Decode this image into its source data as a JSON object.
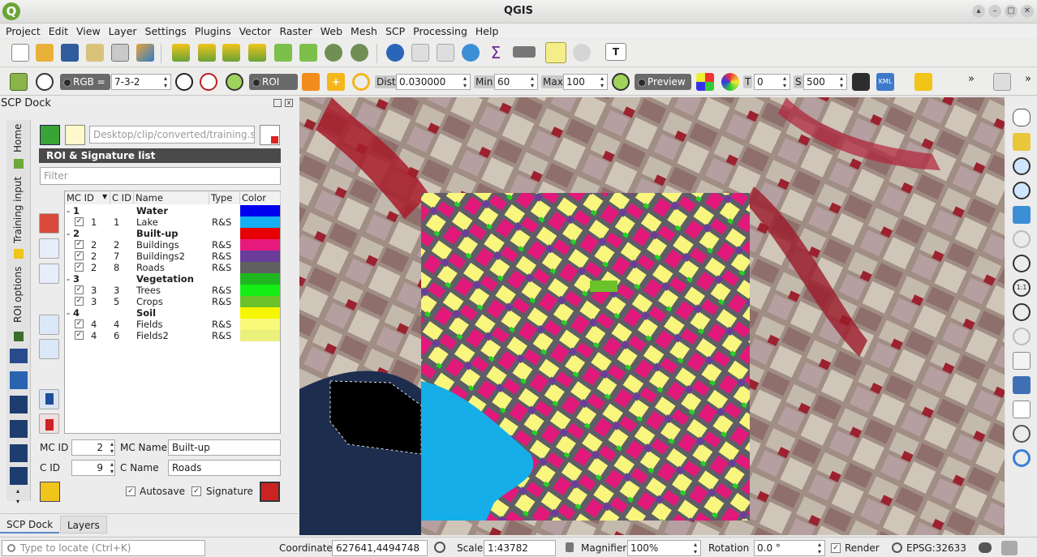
{
  "window": {
    "title": "QGIS"
  },
  "menu": [
    "Project",
    "Edit",
    "View",
    "Layer",
    "Settings",
    "Plugins",
    "Vector",
    "Raster",
    "Web",
    "Mesh",
    "SCP",
    "Processing",
    "Help"
  ],
  "scp_toolbar": {
    "rgb_label": "RGB =",
    "rgb_value": "7-3-2",
    "roi_label": "ROI",
    "dist_label": "Dist",
    "dist_value": "0.030000",
    "min_label": "Min",
    "min_value": "60",
    "max_label": "Max",
    "max_value": "100",
    "preview_label": "Preview",
    "t_label": "T",
    "t_value": "0",
    "s_label": "S",
    "s_value": "500",
    "kml": "KML"
  },
  "dock": {
    "title": "SCP Dock",
    "vertical_tabs": [
      "Home",
      "Training input",
      "ROI options"
    ],
    "training_path": "Desktop/clip/converted/training.scp",
    "panel_title": "ROI & Signature list",
    "filter_placeholder": "Filter",
    "columns": [
      "MC ID",
      "C ID",
      "Name",
      "Type",
      "Color"
    ],
    "rows": [
      {
        "kind": "group",
        "mc": "1",
        "name": "Water",
        "color": "#0000ee"
      },
      {
        "kind": "item",
        "mc": "1",
        "c": "1",
        "name": "Lake",
        "type": "R&S",
        "color": "#14b0f2"
      },
      {
        "kind": "group",
        "mc": "2",
        "name": "Built-up",
        "color": "#e60000"
      },
      {
        "kind": "item",
        "mc": "2",
        "c": "2",
        "name": "Buildings",
        "type": "R&S",
        "color": "#e8197c"
      },
      {
        "kind": "item",
        "mc": "2",
        "c": "7",
        "name": "Buildings2",
        "type": "R&S",
        "color": "#6a3d9a"
      },
      {
        "kind": "item",
        "mc": "2",
        "c": "8",
        "name": "Roads",
        "type": "R&S",
        "color": "#606060"
      },
      {
        "kind": "group",
        "mc": "3",
        "name": "Vegetation",
        "color": "#1fb61f"
      },
      {
        "kind": "item",
        "mc": "3",
        "c": "3",
        "name": "Trees",
        "type": "R&S",
        "color": "#14ee14"
      },
      {
        "kind": "item",
        "mc": "3",
        "c": "5",
        "name": "Crops",
        "type": "R&S",
        "color": "#6cc22a"
      },
      {
        "kind": "group",
        "mc": "4",
        "name": "Soil",
        "color": "#f6f600"
      },
      {
        "kind": "item",
        "mc": "4",
        "c": "4",
        "name": "Fields",
        "type": "R&S",
        "color": "#f9f97a"
      },
      {
        "kind": "item",
        "mc": "4",
        "c": "6",
        "name": "Fields2",
        "type": "R&S",
        "color": "#ebef7b"
      }
    ],
    "mc_id_label": "MC ID",
    "mc_id_value": "2",
    "mc_name_label": "MC Name",
    "mc_name_value": "Built-up",
    "c_id_label": "C ID",
    "c_id_value": "9",
    "c_name_label": "C Name",
    "c_name_value": "Roads",
    "autosave_label": "Autosave",
    "signature_label": "Signature",
    "bottom_tabs": [
      "SCP Dock",
      "Layers"
    ]
  },
  "status": {
    "locate_placeholder": "Type to locate (Ctrl+K)",
    "coordinate_label": "Coordinate",
    "coordinate_value": "627641,4494748",
    "scale_label": "Scale",
    "scale_value": "1:43782",
    "magnifier_label": "Magnifier",
    "magnifier_value": "100%",
    "rotation_label": "Rotation",
    "rotation_value": "0.0 °",
    "render_label": "Render",
    "crs": "EPSG:32633"
  }
}
